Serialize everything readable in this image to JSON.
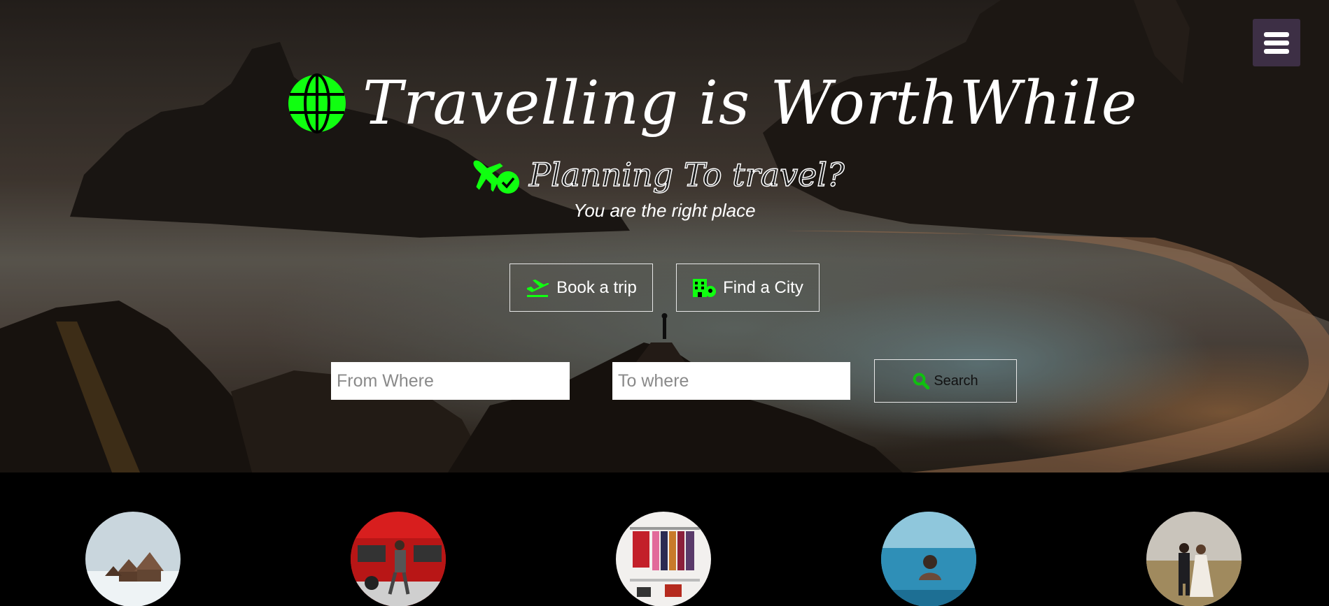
{
  "hero": {
    "title": "Travelling is WorthWhile",
    "subtitle": "Planning To travel?",
    "tagline": "You are the right place"
  },
  "icons": {
    "menu": "hamburger-menu-icon",
    "title": "globe-icon",
    "subtitle": "plane-check-icon",
    "book": "plane-departure-icon",
    "city": "city-location-icon",
    "search": "search-icon"
  },
  "colors": {
    "accent": "#10ff10",
    "menu_bg": "#3d2f45"
  },
  "actions": {
    "book_label": "Book a trip",
    "city_label": "Find a City"
  },
  "search": {
    "from_placeholder": "From Where",
    "to_placeholder": "To where",
    "button_label": "Search"
  },
  "gallery": {
    "items": [
      "snowy-cabins-image",
      "red-bus-walker-image",
      "clothing-store-image",
      "infinity-pool-image",
      "couple-field-image"
    ]
  }
}
